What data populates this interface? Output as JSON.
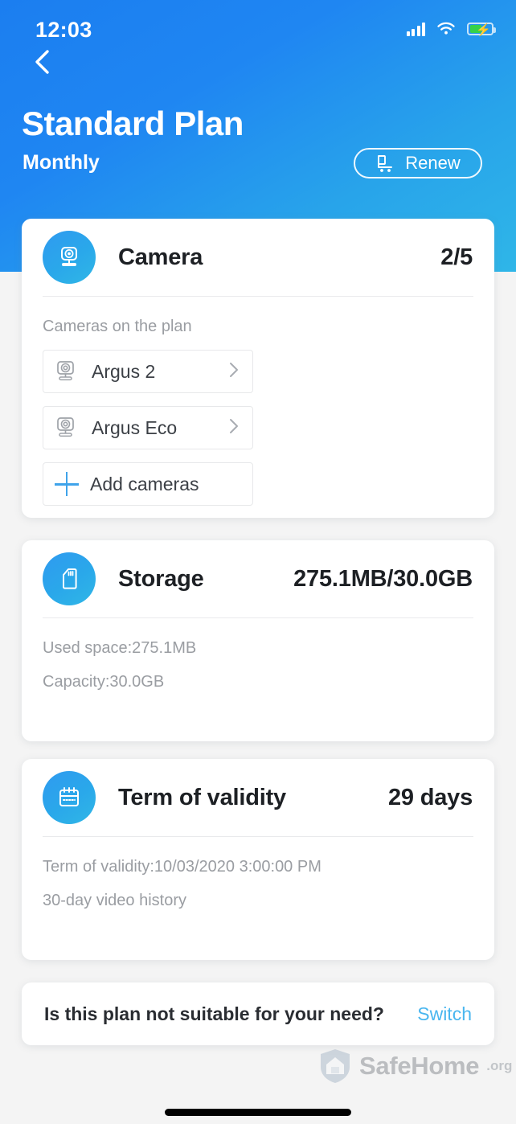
{
  "status_bar": {
    "time": "12:03",
    "signal_icon": "cellular-signal-icon",
    "wifi_icon": "wifi-icon",
    "battery_icon": "battery-charging-icon",
    "battery_color": "#35d24a"
  },
  "header": {
    "back_icon": "chevron-left-icon",
    "title": "Standard Plan",
    "subtitle": "Monthly",
    "renew_label": "Renew",
    "renew_icon": "shopping-cart-icon",
    "accent_start": "#1b7ef0",
    "accent_end": "#2fb6e8"
  },
  "cards": {
    "camera": {
      "icon": "camera-icon",
      "title": "Camera",
      "value": "2/5",
      "body_label": "Cameras on the plan",
      "devices": [
        {
          "name": "Argus 2",
          "icon": "camera-device-icon",
          "chevron": "chevron-right-icon"
        },
        {
          "name": "Argus Eco",
          "icon": "camera-device-icon",
          "chevron": "chevron-right-icon"
        }
      ],
      "add_label": "Add cameras",
      "add_icon": "plus-icon"
    },
    "storage": {
      "icon": "sd-card-icon",
      "title": "Storage",
      "value": "275.1MB/30.0GB",
      "lines": [
        "Used space:275.1MB",
        "Capacity:30.0GB"
      ]
    },
    "validity": {
      "icon": "calendar-icon",
      "title": "Term of validity",
      "value": "29 days",
      "lines": [
        "Term of validity:10/03/2020 3:00:00 PM",
        "30-day video history"
      ]
    }
  },
  "switch_plan": {
    "question": "Is this plan not suitable for your need?",
    "action_label": "Switch",
    "action_color": "#49b6ef"
  },
  "watermark": {
    "icon": "shield-house-logo-icon",
    "name": "SafeHome",
    "tld": ".org"
  }
}
